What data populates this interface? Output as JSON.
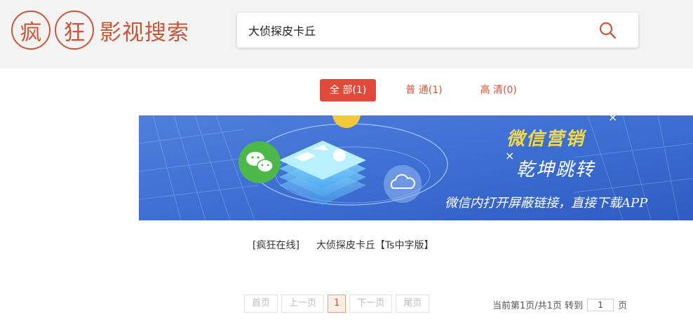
{
  "header": {
    "logo_char1": "疯",
    "logo_char2": "狂",
    "logo_text": "影视搜索",
    "brand_color": "#c8573a"
  },
  "search": {
    "value": "大侦探皮卡丘",
    "icon": "search-icon"
  },
  "tabs": [
    {
      "label": "全 部(1)",
      "active": true
    },
    {
      "label": "普 通(1)",
      "active": false
    },
    {
      "label": "高 清(0)",
      "active": false
    }
  ],
  "banner": {
    "title1": "微信营销",
    "title2": "乾坤跳转",
    "subtitle": "微信内打开屏蔽链接，直接下载APP",
    "close_char": "X",
    "icons": [
      "wechat-icon",
      "cloud-icon"
    ]
  },
  "result": {
    "source": "[疯狂在线]",
    "title": "大侦探皮卡丘【Ts中字版】"
  },
  "pagination": {
    "first": "首页",
    "prev": "上一页",
    "current": "1",
    "next": "下一页",
    "last": "尾页",
    "info": "当前第1页/共1页 转到",
    "goto_value": "1",
    "unit": "页"
  }
}
